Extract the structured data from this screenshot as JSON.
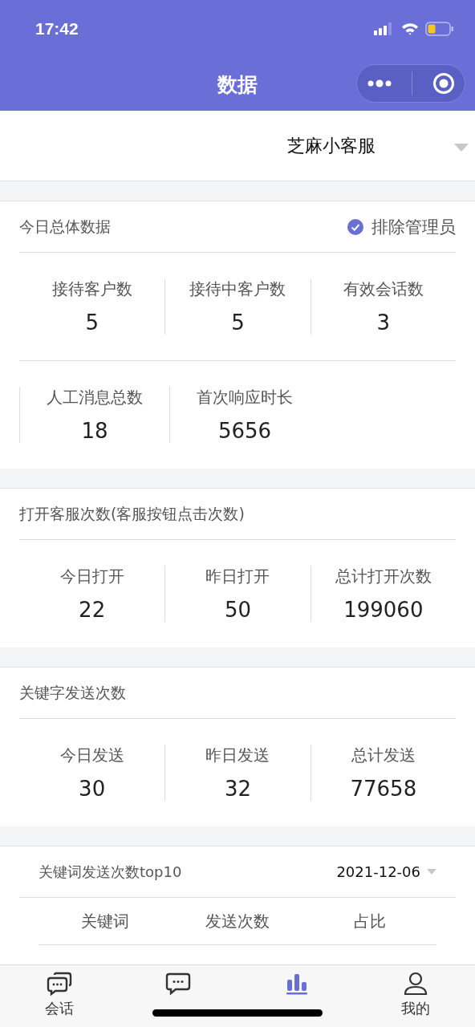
{
  "status_bar": {
    "time": "17:42"
  },
  "nav": {
    "title": "数据"
  },
  "selector": {
    "value": "芝麻小客服"
  },
  "sections": [
    {
      "kind": "stats",
      "title": "今日总体数据",
      "option": {
        "label": "排除管理员",
        "checked": true
      },
      "rows": [
        [
          {
            "label": "接待客户数",
            "value": "5"
          },
          {
            "label": "接待中客户数",
            "value": "5"
          },
          {
            "label": "有效会话数",
            "value": "3"
          }
        ],
        [
          {
            "label": "人工消息总数",
            "value": "18"
          },
          {
            "label": "首次响应时长",
            "value": "5656"
          }
        ]
      ]
    },
    {
      "kind": "stats",
      "title": "打开客服次数(客服按钮点击次数)",
      "rows": [
        [
          {
            "label": "今日打开",
            "value": "22"
          },
          {
            "label": "昨日打开",
            "value": "50"
          },
          {
            "label": "总计打开次数",
            "value": "199060"
          }
        ]
      ]
    },
    {
      "kind": "stats",
      "title": "关键字发送次数",
      "rows": [
        [
          {
            "label": "今日发送",
            "value": "30"
          },
          {
            "label": "昨日发送",
            "value": "32"
          },
          {
            "label": "总计发送",
            "value": "77658"
          }
        ]
      ]
    },
    {
      "kind": "table",
      "title": "关键词发送次数top10",
      "date": "2021-12-06",
      "columns": [
        "关键词",
        "发送次数",
        "占比"
      ]
    }
  ],
  "tab_bar": [
    {
      "label": "会话",
      "selected": false
    },
    {
      "selected": false
    },
    {
      "selected": true
    },
    {
      "label": "我的",
      "selected": false
    }
  ]
}
